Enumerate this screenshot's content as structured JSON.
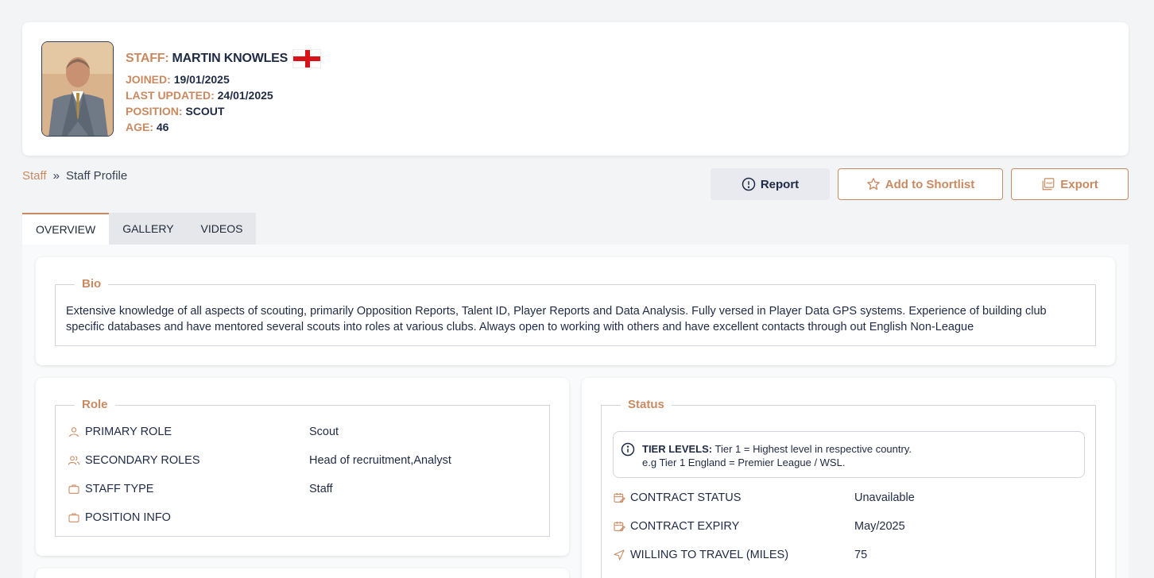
{
  "profile": {
    "staff_label": "STAFF:",
    "name": "MARTIN KNOWLES",
    "flag": "england-flag",
    "joined_label": "JOINED:",
    "joined": "19/01/2025",
    "updated_label": "LAST UPDATED:",
    "updated": "24/01/2025",
    "position_label": "POSITION:",
    "position": "SCOUT",
    "age_label": "AGE:",
    "age": "46"
  },
  "breadcrumb": {
    "root": "Staff",
    "sep": "»",
    "current": "Staff Profile"
  },
  "actions": {
    "report": "Report",
    "shortlist": "Add to Shortlist",
    "export": "Export"
  },
  "tabs": [
    {
      "label": "OVERVIEW"
    },
    {
      "label": "GALLERY"
    },
    {
      "label": "VIDEOS"
    }
  ],
  "bio": {
    "title": "Bio",
    "text": "Extensive knowledge of all aspects of scouting, primarily Opposition Reports, Talent ID, Player Reports and Data Analysis. Fully versed in Player Data GPS systems. Experience of building club specific databases and have mentored several scouts into roles at various clubs. Always open to working with others and have excellent contacts through out English Non-League"
  },
  "role": {
    "title": "Role",
    "rows": [
      {
        "label": "PRIMARY ROLE",
        "value": "Scout",
        "icon": "user-icon"
      },
      {
        "label": "SECONDARY ROLES",
        "value": "Head of recruitment,Analyst",
        "icon": "users-icon"
      },
      {
        "label": "STAFF TYPE",
        "value": "Staff",
        "icon": "briefcase-icon"
      },
      {
        "label": "POSITION INFO",
        "value": "",
        "icon": "briefcase-icon"
      }
    ]
  },
  "status": {
    "title": "Status",
    "notice_bold": "TIER LEVELS:",
    "notice_line1": " Tier 1 = Highest level in respective country.",
    "notice_line2": "e.g Tier 1 England = Premier League / WSL.",
    "rows": [
      {
        "label": "CONTRACT STATUS",
        "value": "Unavailable",
        "icon": "calendar-edit-icon"
      },
      {
        "label": "CONTRACT EXPIRY",
        "value": "May/2025",
        "icon": "calendar-edit-icon"
      },
      {
        "label": "WILLING TO TRAVEL (MILES)",
        "value": "75",
        "icon": "send-icon"
      }
    ]
  },
  "colors": {
    "accent": "#c98a62",
    "text": "#1f2a44",
    "background": "#f3f4f6"
  }
}
